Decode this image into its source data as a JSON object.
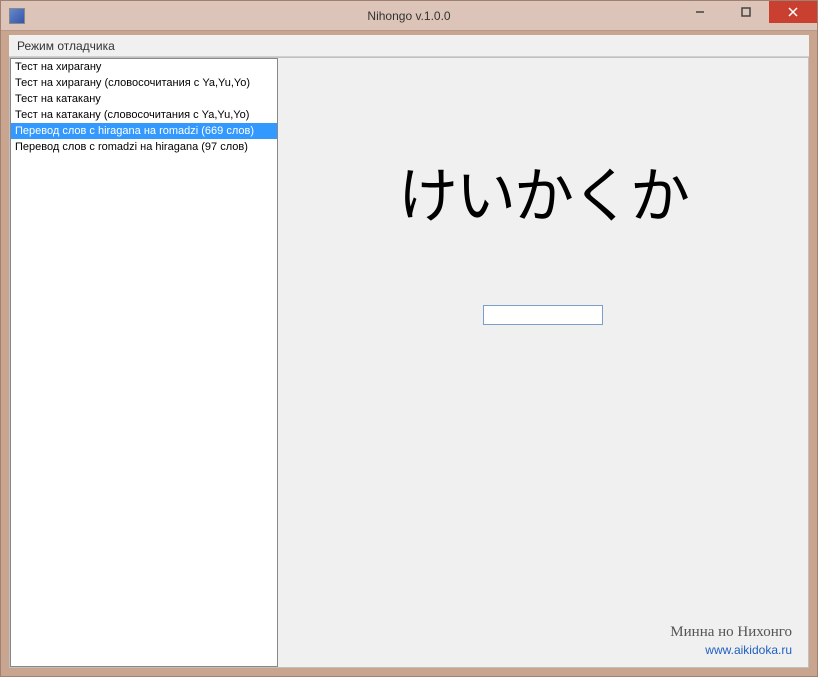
{
  "window": {
    "title": "Nihongo v.1.0.0"
  },
  "menubar": {
    "debug_mode": "Режим отладчика"
  },
  "sidebar": {
    "items": [
      {
        "label": "Тест на хирагану",
        "selected": false
      },
      {
        "label": "Тест на хирагану (словосочитания с Ya,Yu,Yo)",
        "selected": false
      },
      {
        "label": "Тест на катакану",
        "selected": false
      },
      {
        "label": "Тест на катакану (словосочитания с Ya,Yu,Yo)",
        "selected": false
      },
      {
        "label": "Перевод слов с hiragana на romadzi (669 слов)",
        "selected": true
      },
      {
        "label": "Перевод слов с romadzi на hiragana (97 слов)",
        "selected": false
      }
    ]
  },
  "main": {
    "word": "けいかくか",
    "input_value": ""
  },
  "footer": {
    "title": "Минна но Нихонго",
    "link": "www.aikidoka.ru"
  }
}
